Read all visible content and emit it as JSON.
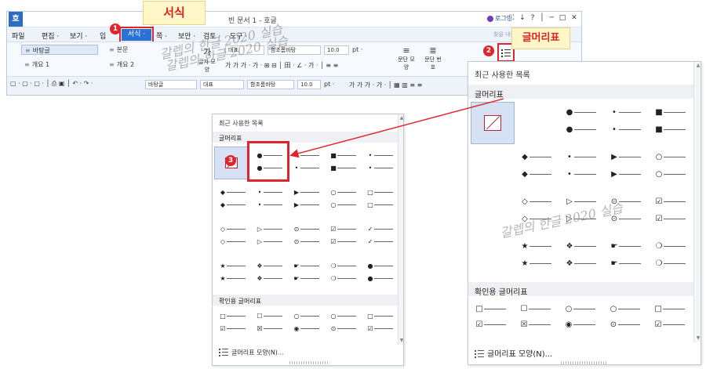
{
  "window": {
    "logo": "호",
    "title": "빈 문서 1 - 호글",
    "login": "로그인",
    "controls": "⛶ ↓ ? │ ─ □ ✕"
  },
  "menu": {
    "items": [
      "파일",
      "편집 ·",
      "보기 ·",
      "입"
    ],
    "format": "서식 ·",
    "rest": [
      "쪽 ·",
      "보안 ·",
      "검토 ·",
      "도구 ·"
    ],
    "hint": "찾을 내용"
  },
  "ribbon": {
    "styles": [
      "바탕글",
      "본문",
      "개요 1",
      "개요 2"
    ],
    "para_shape": "글자 모양",
    "font_type": "대표",
    "font_name": "함초롬바탕",
    "font_size": "10.0",
    "unit": "pt ·",
    "format_buttons": "가 가 가 · 가 · ⊞ ⊟ │ 田 · ∠ · 가 · │ ≡ ≡",
    "para_label": "문단 모양",
    "para_label2": "문단 번호"
  },
  "toolbar2": {
    "style": "바탕글",
    "font_type": "대표",
    "font_name": "함초롬바탕",
    "font_size": "10.0",
    "unit": "pt ·"
  },
  "callouts": {
    "format_label": "서식",
    "bullet_label": "글머리표",
    "badges": [
      "1",
      "2",
      "3"
    ]
  },
  "watermark": "갈렙의 한글 2020 실습",
  "bullet_panel": {
    "recent_title": "최근 사용한 목록",
    "bullets_title": "글머리표",
    "check_title": "확인용 글머리표",
    "footer": "글머리표 모양(N)...",
    "rows": [
      [
        "",
        "●",
        "•",
        "■",
        "•"
      ],
      [
        "◆",
        "•",
        "▶",
        "○",
        "□"
      ],
      [
        "◇",
        "▷",
        "⊙",
        "☑",
        "✓"
      ],
      [
        "★",
        "❖",
        "☛",
        "❍",
        "●"
      ]
    ],
    "check_rows": [
      [
        "□",
        "☐",
        "○",
        "○",
        "□"
      ],
      [
        "☑",
        "☒",
        "◉",
        "⊙",
        "☑"
      ]
    ]
  },
  "icons": {
    "none_bullet": "none-bullet-icon",
    "bullet_list": "bullet-list-icon"
  },
  "colors": {
    "accent": "#2b72d6",
    "highlight": "#e0242e",
    "callout_bg": "#fff7c8"
  }
}
